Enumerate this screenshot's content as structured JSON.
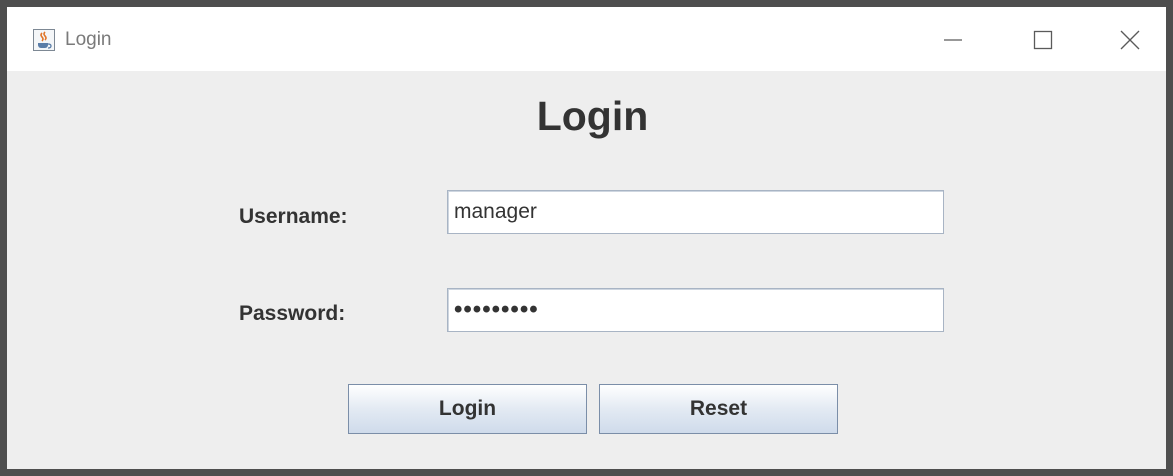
{
  "window": {
    "title": "Login",
    "icon": "java-coffee-icon",
    "controls": [
      "minimize-icon",
      "maximize-icon",
      "close-icon"
    ]
  },
  "form": {
    "heading": "Login",
    "username_label": "Username:",
    "username_value": "manager",
    "password_label": "Password:",
    "password_display": "•••••••••",
    "login_button": "Login",
    "reset_button": "Reset"
  },
  "colors": {
    "window_border": "#4e4e4e",
    "background": "#eeeeee",
    "text": "#333333",
    "button_border": "#7b8ea8"
  }
}
